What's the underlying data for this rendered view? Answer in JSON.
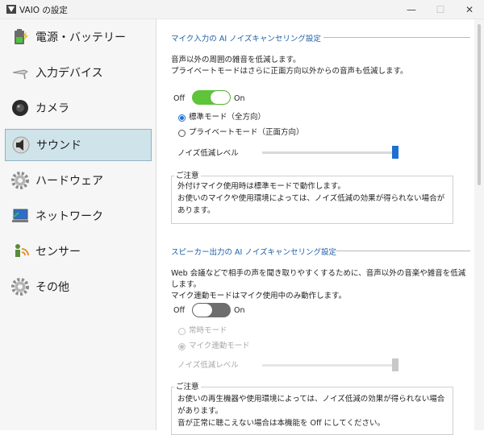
{
  "window": {
    "title": "VAIO の設定",
    "icon": "vaio-app-icon",
    "controls": {
      "minimize": "—",
      "maximize": "☐",
      "close": "✕"
    }
  },
  "sidebar": {
    "items": [
      {
        "label": "電源・バッテリー",
        "icon": "battery-icon",
        "selected": false
      },
      {
        "label": "入力デバイス",
        "icon": "pen-icon",
        "selected": false
      },
      {
        "label": "カメラ",
        "icon": "camera-icon",
        "selected": false
      },
      {
        "label": "サウンド",
        "icon": "speaker-icon",
        "selected": true
      },
      {
        "label": "ハードウェア",
        "icon": "gear-icon",
        "selected": false
      },
      {
        "label": "ネットワーク",
        "icon": "network-icon",
        "selected": false
      },
      {
        "label": "センサー",
        "icon": "sensor-icon",
        "selected": false
      },
      {
        "label": "その他",
        "icon": "gear-icon",
        "selected": false
      }
    ]
  },
  "mic": {
    "heading": "マイク入力の AI ノイズキャンセリング設定",
    "desc1": "音声以外の周囲の雑音を低減します。",
    "desc2": "プライベートモードはさらに正面方向以外からの音声も低減します。",
    "toggle": {
      "off_label": "Off",
      "on_label": "On",
      "state": "on"
    },
    "radio1": "標準モード（全方向）",
    "radio2": "プライベートモード（正面方向）",
    "selected_mode": "標準モード（全方向）",
    "level_label": "ノイズ低減レベル",
    "level_fraction": 1.0,
    "notice": {
      "title": "ご注意",
      "line1": "外付けマイク使用時は標準モードで動作します。",
      "line2": "お使いのマイクや使用環境によっては、ノイズ低減の効果が得られない場合が",
      "line3": "あります。"
    }
  },
  "speaker": {
    "heading": "スピーカー出力の AI ノイズキャンセリング設定",
    "desc1": "Web 会議などで相手の声を聞き取りやすくするために、音声以外の音楽や雑音を低減",
    "desc2": "します。",
    "desc3": "マイク連動モードはマイク使用中のみ動作します。",
    "toggle": {
      "off_label": "Off",
      "on_label": "On",
      "state": "off"
    },
    "radio1": "常時モード",
    "radio2": "マイク連動モード",
    "selected_mode": "マイク連動モード",
    "level_label": "ノイズ低減レベル",
    "level_fraction": 1.0,
    "notice": {
      "title": "ご注意",
      "line1": "お使いの再生機器や使用環境によっては、ノイズ低減の効果が得られない場合",
      "line2": "があります。",
      "line3": "音が正常に聴こえない場合は本機能を Off にしてください。"
    }
  },
  "colors": {
    "accent_blue": "#1e6fd0",
    "toggle_on": "#5ec43a",
    "toggle_off": "#6e6e6e",
    "selected_bg": "#cfe4ea",
    "heading": "#1f5ea8"
  }
}
